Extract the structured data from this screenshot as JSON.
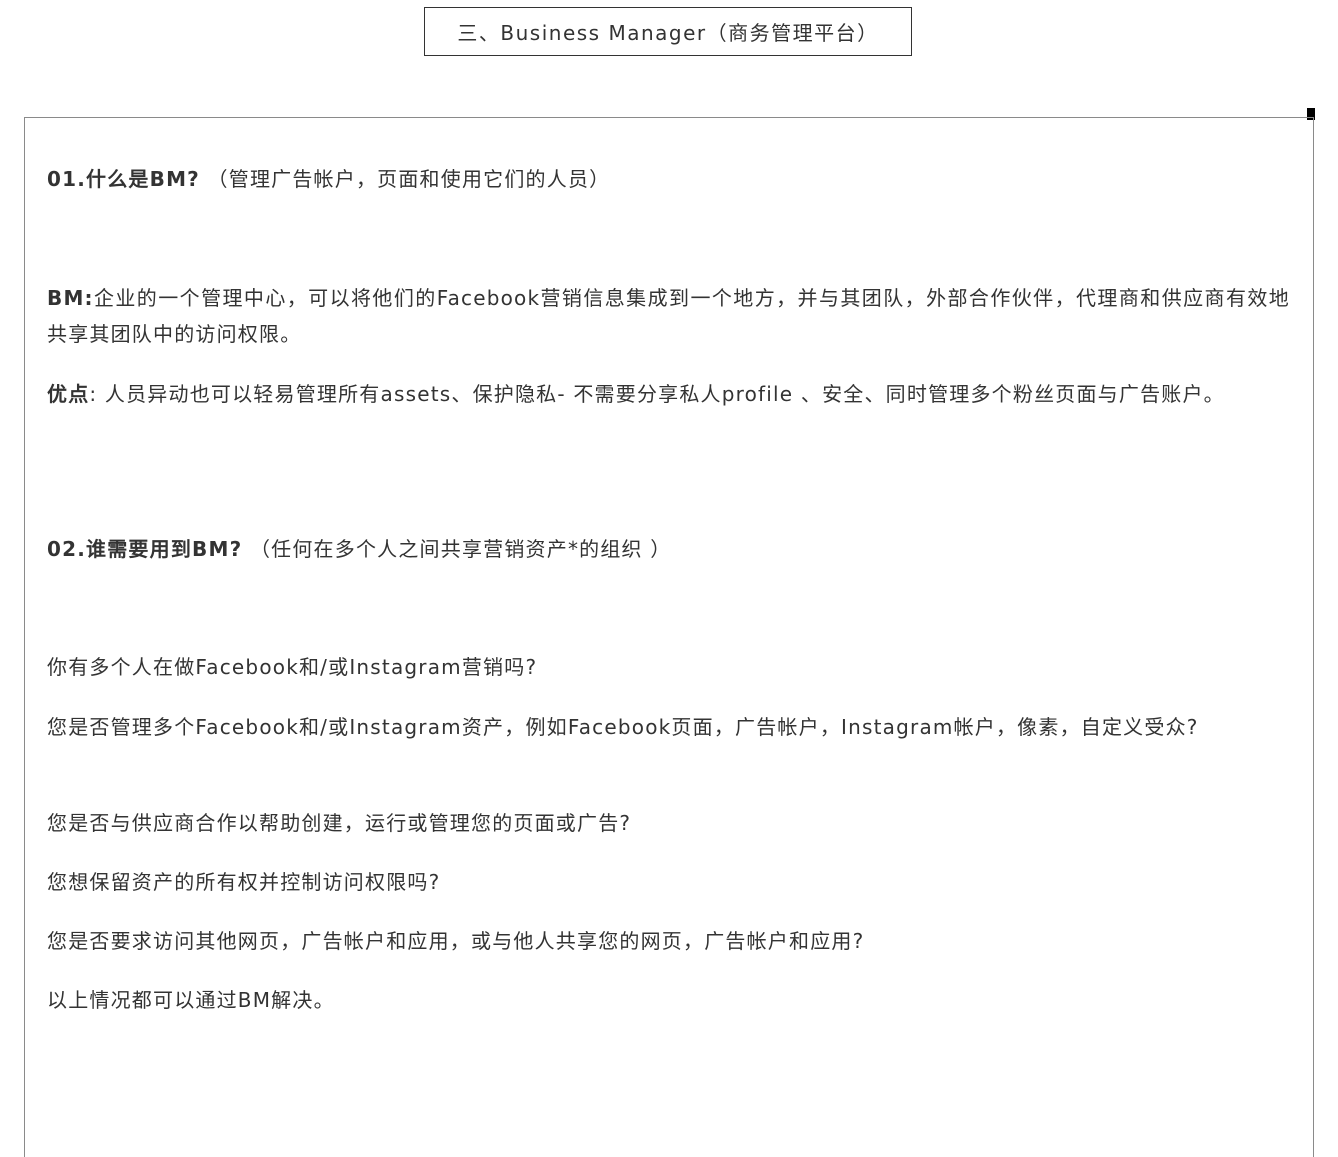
{
  "title": "三、Business Manager（商务管理平台）",
  "sections": [
    {
      "heading_bold": "01.什么是BM?",
      "heading_rest": "（管理广告帐户，页面和使用它们的人员）"
    },
    {
      "label": "BM:",
      "text": "企业的一个管理中心，可以将他们的Facebook营销信息集成到一个地方，并与其团队，外部合作伙伴，代理商和供应商有效地共享其团队中的访问权限。"
    },
    {
      "label": "优点",
      "text": ": 人员异动也可以轻易管理所有assets、保护隐私- 不需要分享私人profile 、安全、同时管理多个粉丝页面与广告账户。"
    },
    {
      "heading_bold": "02.谁需要用到BM?",
      "heading_rest": "（任何在多个人之间共享营销资产*的组织 ）"
    }
  ],
  "questions": [
    "你有多个人在做Facebook和/或Instagram营销吗?",
    "您是否管理多个Facebook和/或Instagram资产，例如Facebook页面，广告帐户，Instagram帐户，像素，自定义受众?",
    "您是否与供应商合作以帮助创建，运行或管理您的页面或广告?",
    "您想保留资产的所有权并控制访问权限吗?",
    "您是否要求访问其他网页，广告帐户和应用，或与他人共享您的网页，广告帐户和应用?",
    "以上情况都可以通过BM解决。"
  ]
}
